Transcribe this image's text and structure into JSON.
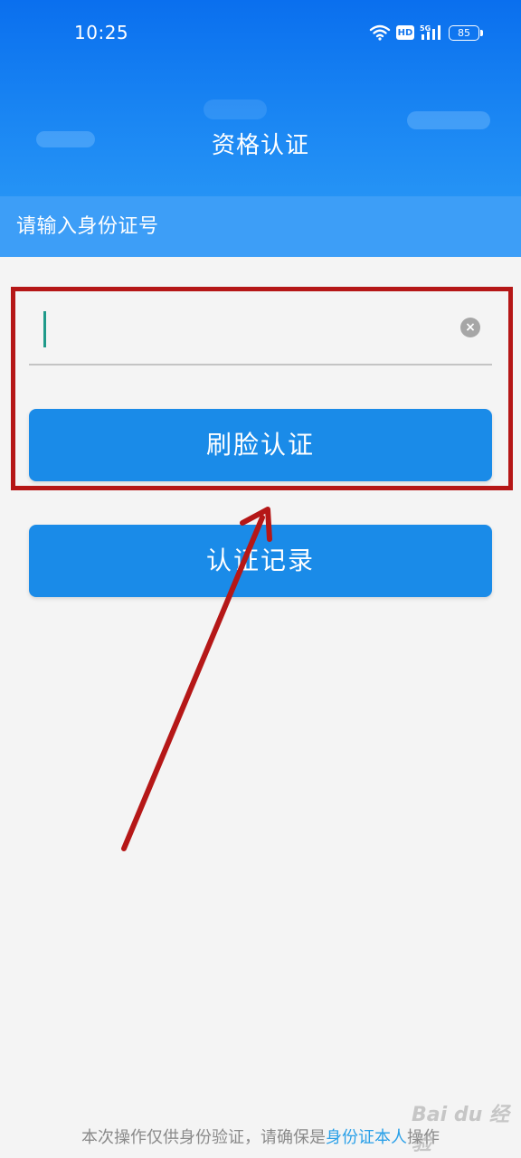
{
  "status_bar": {
    "time": "10:25",
    "hd": "HD",
    "network": "5G",
    "battery": "85"
  },
  "header": {
    "title": "资格认证",
    "subtitle": "请输入身份证号"
  },
  "form": {
    "id_input_value": "",
    "id_input_placeholder": ""
  },
  "buttons": {
    "face_auth": "刷脸认证",
    "auth_record": "认证记录"
  },
  "footer": {
    "text_before": "本次操作仅供身份验证，请确保是",
    "link": "身份证本人",
    "text_after": "操作"
  },
  "watermark": "Bai du 经验",
  "colors": {
    "header_blue": "#0a6fee",
    "subheader_blue": "#3d9ef7",
    "button_blue": "#1a8be8",
    "highlight_red": "#b51717",
    "link_blue": "#2aa0e8"
  }
}
